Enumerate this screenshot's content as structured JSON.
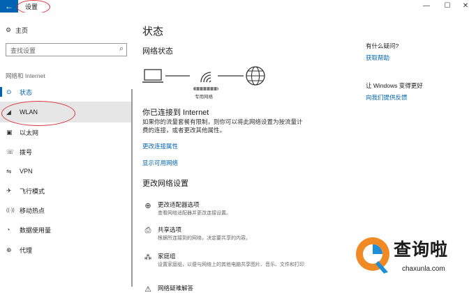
{
  "titlebar": {
    "back_glyph": "←",
    "title": "设置",
    "min_glyph": "—",
    "max_glyph": "☐",
    "close_glyph": "✕"
  },
  "sidebar": {
    "home_label": "主页",
    "search_placeholder": "查找设置",
    "section_title": "网络和 Internet",
    "items": [
      {
        "label": "状态",
        "icon": "home-network-icon",
        "glyph": "⊙",
        "active": true
      },
      {
        "label": "WLAN",
        "icon": "wifi-icon",
        "glyph": "◢",
        "hover": true
      },
      {
        "label": "以太网",
        "icon": "ethernet-icon",
        "glyph": "▣"
      },
      {
        "label": "拨号",
        "icon": "dialup-icon",
        "glyph": "☏"
      },
      {
        "label": "VPN",
        "icon": "vpn-icon",
        "glyph": "⇋"
      },
      {
        "label": "飞行模式",
        "icon": "airplane-icon",
        "glyph": "✈"
      },
      {
        "label": "移动热点",
        "icon": "hotspot-icon",
        "glyph": "((·))"
      },
      {
        "label": "数据使用量",
        "icon": "data-usage-icon",
        "glyph": "◔"
      },
      {
        "label": "代理",
        "icon": "globe-icon",
        "glyph": "⊕"
      }
    ]
  },
  "main": {
    "title": "状态",
    "network_status_heading": "网络状态",
    "diagram_caption": "专用网络",
    "connected_title": "你已连接到 Internet",
    "connected_desc": "如果你的流量套餐有限制，则你可以将此网络设置为按流量计费的连接，或者更改其他属性。",
    "link_change_props": "更改连接属性",
    "link_show_networks": "显示可用网络",
    "change_settings_heading": "更改网络设置",
    "options": [
      {
        "title": "更改适配器选项",
        "desc": "查看网络适配器并更改连接设置。",
        "icon": "adapter-icon",
        "glyph": "⊕"
      },
      {
        "title": "共享选项",
        "desc": "根据所连接到的网络，决定要共享的内容。",
        "icon": "sharing-icon",
        "glyph": "⎙"
      },
      {
        "title": "家庭组",
        "desc": "设置家庭组，以便与网络上的其他电脑共享图片、音乐、文件和打印",
        "icon": "homegroup-icon",
        "glyph": "⁂"
      },
      {
        "title": "网络疑难解答",
        "desc": "",
        "icon": "warning-icon",
        "glyph": "⚠"
      }
    ]
  },
  "right_panel": {
    "question": "有什么疑问?",
    "help_link": "获取帮助",
    "better_title": "让 Windows 变得更好",
    "feedback_link": "向我们提供反馈"
  },
  "watermark": {
    "text": "查询啦",
    "sub": "chaxunla.com",
    "colors": {
      "orange": "#f08a24",
      "blue": "#1e8fd6"
    }
  },
  "colors": {
    "accent": "#0063b1",
    "annotation_red": "#d9373f"
  }
}
